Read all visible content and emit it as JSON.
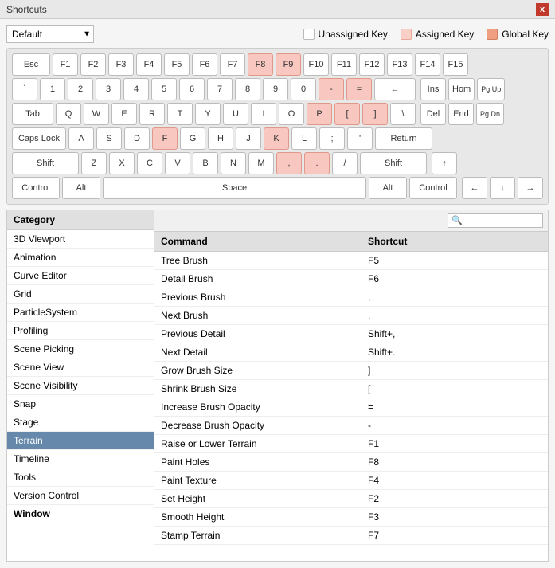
{
  "titleBar": {
    "title": "Shortcuts",
    "closeLabel": "x"
  },
  "toolbar": {
    "dropdownValue": "Default",
    "dropdownOptions": [
      "Default"
    ],
    "legends": [
      {
        "label": "Unassigned Key",
        "type": "unassigned"
      },
      {
        "label": "Assigned Key",
        "type": "assigned"
      },
      {
        "label": "Global Key",
        "type": "global"
      }
    ]
  },
  "keyboard": {
    "rows": [
      {
        "id": "row-fn",
        "keys": [
          {
            "label": "Esc",
            "class": ""
          },
          {
            "label": "F1",
            "class": ""
          },
          {
            "label": "F2",
            "class": ""
          },
          {
            "label": "F3",
            "class": ""
          },
          {
            "label": "F4",
            "class": ""
          },
          {
            "label": "F5",
            "class": ""
          },
          {
            "label": "F6",
            "class": ""
          },
          {
            "label": "F7",
            "class": ""
          },
          {
            "label": "F8",
            "class": "highlighted"
          },
          {
            "label": "F9",
            "class": "highlighted"
          },
          {
            "label": "F10",
            "class": ""
          },
          {
            "label": "F11",
            "class": ""
          },
          {
            "label": "F12",
            "class": ""
          },
          {
            "label": "F13",
            "class": ""
          },
          {
            "label": "F14",
            "class": ""
          },
          {
            "label": "F15",
            "class": ""
          }
        ]
      }
    ]
  },
  "categories": {
    "header": "Category",
    "items": [
      {
        "label": "3D Viewport",
        "selected": false
      },
      {
        "label": "Animation",
        "selected": false
      },
      {
        "label": "Curve Editor",
        "selected": false
      },
      {
        "label": "Grid",
        "selected": false
      },
      {
        "label": "ParticleSystem",
        "selected": false
      },
      {
        "label": "Profiling",
        "selected": false
      },
      {
        "label": "Scene Picking",
        "selected": false
      },
      {
        "label": "Scene View",
        "selected": false
      },
      {
        "label": "Scene Visibility",
        "selected": false
      },
      {
        "label": "Snap",
        "selected": false
      },
      {
        "label": "Stage",
        "selected": false
      },
      {
        "label": "Terrain",
        "selected": true
      },
      {
        "label": "Timeline",
        "selected": false
      },
      {
        "label": "Tools",
        "selected": false
      },
      {
        "label": "Version Control",
        "selected": false
      },
      {
        "label": "Window",
        "selected": false,
        "bold": true
      }
    ]
  },
  "commands": {
    "commandHeader": "Command",
    "shortcutHeader": "Shortcut",
    "searchPlaceholder": "🔍",
    "items": [
      {
        "command": "Tree Brush",
        "shortcut": "F5"
      },
      {
        "command": "Detail Brush",
        "shortcut": "F6"
      },
      {
        "command": "Previous Brush",
        "shortcut": ","
      },
      {
        "command": "Next Brush",
        "shortcut": "."
      },
      {
        "command": "Previous Detail",
        "shortcut": "Shift+,"
      },
      {
        "command": "Next Detail",
        "shortcut": "Shift+."
      },
      {
        "command": "Grow Brush Size",
        "shortcut": "]"
      },
      {
        "command": "Shrink Brush Size",
        "shortcut": "["
      },
      {
        "command": "Increase Brush Opacity",
        "shortcut": "="
      },
      {
        "command": "Decrease Brush Opacity",
        "shortcut": "-"
      },
      {
        "command": "Raise or Lower Terrain",
        "shortcut": "F1"
      },
      {
        "command": "Paint Holes",
        "shortcut": "F8"
      },
      {
        "command": "Paint Texture",
        "shortcut": "F4"
      },
      {
        "command": "Set Height",
        "shortcut": "F2"
      },
      {
        "command": "Smooth Height",
        "shortcut": "F3"
      },
      {
        "command": "Stamp Terrain",
        "shortcut": "F7"
      }
    ]
  }
}
